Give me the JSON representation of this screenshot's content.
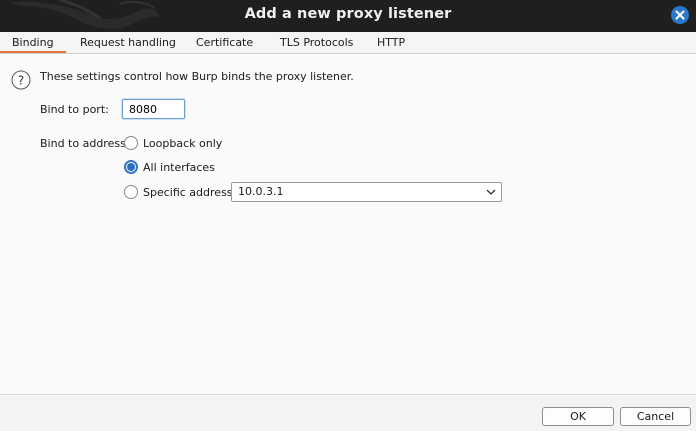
{
  "window": {
    "title": "Add a new proxy listener"
  },
  "tabs": [
    {
      "label": "Binding",
      "active": true
    },
    {
      "label": "Request handling",
      "active": false
    },
    {
      "label": "Certificate",
      "active": false
    },
    {
      "label": "TLS Protocols",
      "active": false
    },
    {
      "label": "HTTP",
      "active": false
    }
  ],
  "binding": {
    "help_text": "These settings control how Burp binds the proxy listener.",
    "port_label": "Bind to port:",
    "port_value": "8080",
    "address_label": "Bind to address:",
    "options": [
      {
        "label": "Loopback only",
        "selected": false
      },
      {
        "label": "All interfaces",
        "selected": true
      },
      {
        "label": "Specific address:",
        "selected": false
      }
    ],
    "specific_address_value": "10.0.3.1"
  },
  "footer": {
    "ok_label": "OK",
    "cancel_label": "Cancel"
  },
  "colors": {
    "accent": "#e5743b",
    "radio_selected": "#2a6fc0",
    "close_button": "#2a78c9",
    "titlebar": "#1f1f1f"
  }
}
